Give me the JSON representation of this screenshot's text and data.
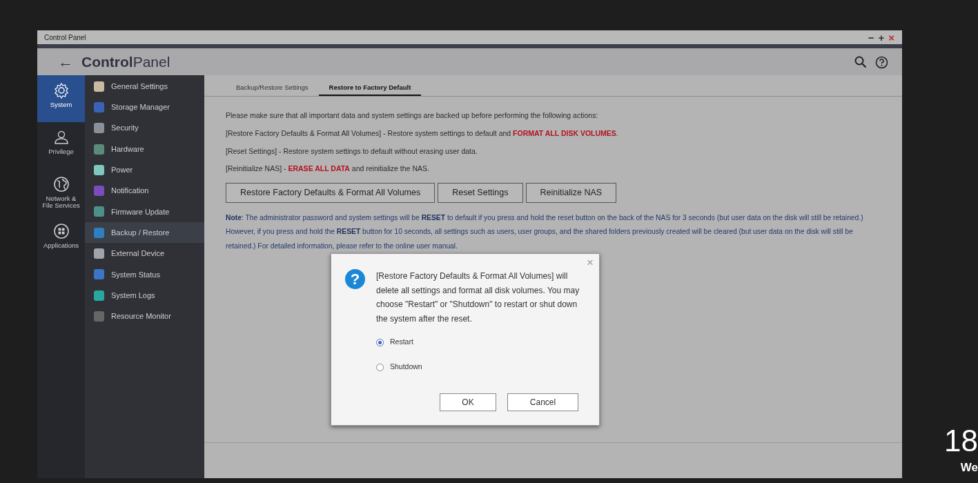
{
  "window": {
    "title": "Control Panel",
    "window_buttons": [
      "−",
      "+",
      "×"
    ]
  },
  "header": {
    "back": "←",
    "title_bold": "Control",
    "title_light": "Panel"
  },
  "rail": [
    {
      "label": "System",
      "kind": "gear",
      "selected": true
    },
    {
      "label": "Privilege",
      "kind": "person",
      "selected": false
    },
    {
      "label": "Network & File Services",
      "kind": "globe",
      "selected": false
    },
    {
      "label": "Applications",
      "kind": "grid",
      "selected": false
    }
  ],
  "menu": [
    {
      "label": "General Settings",
      "selected": false
    },
    {
      "label": "Storage Manager",
      "selected": false
    },
    {
      "label": "Security",
      "selected": false
    },
    {
      "label": "Hardware",
      "selected": false
    },
    {
      "label": "Power",
      "selected": false
    },
    {
      "label": "Notification",
      "selected": false
    },
    {
      "label": "Firmware Update",
      "selected": false
    },
    {
      "label": "Backup / Restore",
      "selected": true
    },
    {
      "label": "External Device",
      "selected": false
    },
    {
      "label": "System Status",
      "selected": false
    },
    {
      "label": "System Logs",
      "selected": false
    },
    {
      "label": "Resource Monitor",
      "selected": false
    }
  ],
  "tabs": [
    {
      "label": "Backup/Restore Settings",
      "selected": false
    },
    {
      "label": "Restore to Factory Default",
      "selected": true
    }
  ],
  "paragraphs": [
    [
      {
        "kind": "plain",
        "text": "Please make sure that all important data and system settings are backed up before performing the following actions:"
      }
    ],
    [
      {
        "kind": "plain",
        "text": "[Restore Factory Defaults & Format All Volumes] - Restore system settings to default and "
      },
      {
        "kind": "warning",
        "text": "FORMAT ALL DISK VOLUMES"
      },
      {
        "kind": "plain",
        "text": "."
      }
    ],
    [
      {
        "kind": "plain",
        "text": "[Reset Settings] - Restore system settings to default without erasing user data."
      }
    ],
    [
      {
        "kind": "plain",
        "text": "[Reinitialize NAS] - "
      },
      {
        "kind": "warning",
        "text": "ERASE ALL DATA"
      },
      {
        "kind": "plain",
        "text": " and reinitialize the NAS."
      }
    ]
  ],
  "action_buttons": [
    "Restore Factory Defaults & Format All Volumes",
    "Reset Settings",
    "Reinitialize NAS"
  ],
  "note": [
    {
      "kind": "emphasis",
      "text": "Note"
    },
    {
      "kind": "plain",
      "text": ": The administrator password and system settings will be "
    },
    {
      "kind": "emphasis",
      "text": "RESET"
    },
    {
      "kind": "plain",
      "text": " to default if you press and hold the reset button on the back of the NAS for 3 seconds (but user data on the disk will still be retained.) However, if you press and hold the "
    },
    {
      "kind": "emphasis",
      "text": "RESET"
    },
    {
      "kind": "plain",
      "text": " button for 10 seconds, all settings such as users, user groups, and the shared folders previously created will be cleared (but user data on the disk will still be retained.) For detailed information, please refer to the online user manual."
    }
  ],
  "dialog": {
    "close": "×",
    "icon_glyph": "?",
    "message": "[Restore Factory Defaults & Format All Volumes] will delete all settings and format all disk volumes. You may choose \"Restart\" or \"Shutdown\" to restart or shut down the system after the reset.",
    "options": [
      {
        "label": "Restart",
        "selected": true
      },
      {
        "label": "Shutdown",
        "selected": false
      }
    ],
    "buttons": [
      "OK",
      "Cancel"
    ]
  },
  "desktop_clock": {
    "time": "18",
    "date": "We"
  }
}
